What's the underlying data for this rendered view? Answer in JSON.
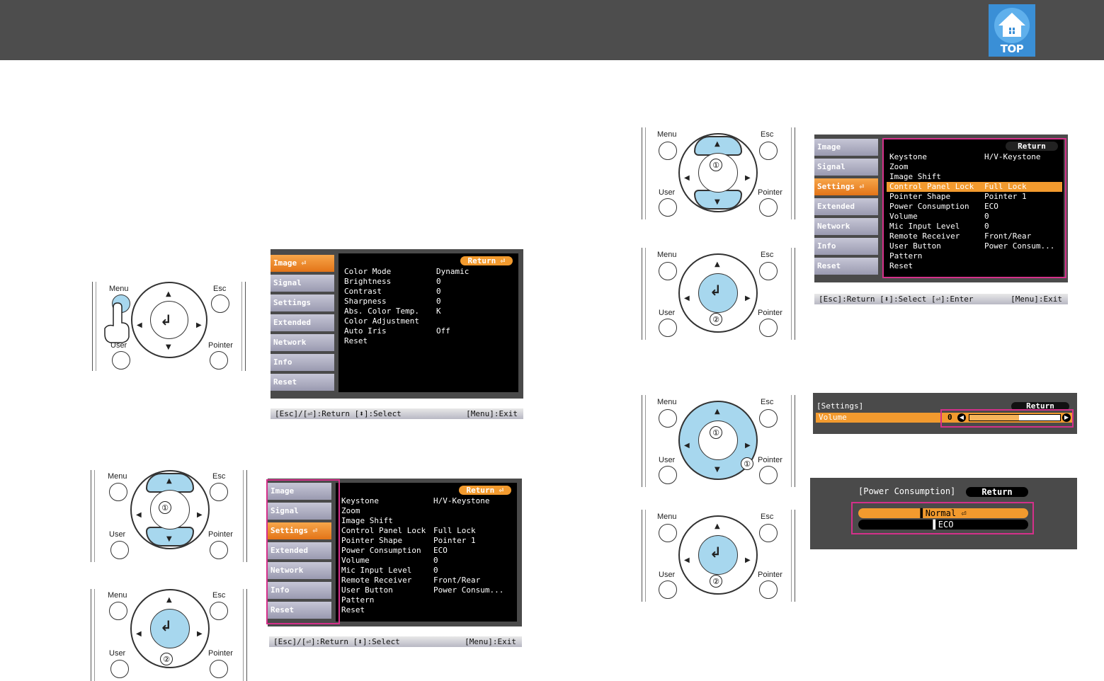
{
  "header": {
    "top_label": "TOP"
  },
  "remote": {
    "menu": "Menu",
    "esc": "Esc",
    "user": "User",
    "pointer": "Pointer",
    "step1": "①",
    "step2": "②"
  },
  "menu_tabs": [
    "Image",
    "Signal",
    "Settings",
    "Extended",
    "Network",
    "Info",
    "Reset"
  ],
  "image_menu": {
    "return": "Return",
    "rows": [
      {
        "k": "Color Mode",
        "v": "Dynamic"
      },
      {
        "k": "Brightness",
        "v": "0"
      },
      {
        "k": "Contrast",
        "v": "0"
      },
      {
        "k": "Sharpness",
        "v": "0"
      },
      {
        "k": "Abs. Color Temp.",
        "v": "K"
      },
      {
        "k": "Color Adjustment",
        "v": ""
      },
      {
        "k": "Auto Iris",
        "v": "Off"
      },
      {
        "k": "Reset",
        "v": ""
      }
    ],
    "hint_left": "[Esc]/[⏎]:Return [⬍]:Select",
    "hint_right": "[Menu]:Exit"
  },
  "settings_menu": {
    "return": "Return",
    "rows": [
      {
        "k": "Keystone",
        "v": "H/V-Keystone"
      },
      {
        "k": "Zoom",
        "v": ""
      },
      {
        "k": "Image Shift",
        "v": ""
      },
      {
        "k": "Control Panel Lock",
        "v": "Full Lock"
      },
      {
        "k": "Pointer Shape",
        "v": "Pointer 1"
      },
      {
        "k": "Power Consumption",
        "v": "ECO"
      },
      {
        "k": "Volume",
        "v": "0"
      },
      {
        "k": "Mic Input Level",
        "v": "0"
      },
      {
        "k": "Remote Receiver",
        "v": "Front/Rear"
      },
      {
        "k": "User Button",
        "v": "Power Consum..."
      },
      {
        "k": "Pattern",
        "v": ""
      },
      {
        "k": "Reset",
        "v": ""
      }
    ],
    "hint_left": "[Esc]/[⏎]:Return [⬍]:Select",
    "hint_right": "[Menu]:Exit"
  },
  "settings_menu_2": {
    "return": "Return",
    "hint_left": "[Esc]:Return [⬍]:Select [⏎]:Enter",
    "hint_right": "[Menu]:Exit"
  },
  "volume_panel": {
    "title": "[Settings]",
    "return": "Return",
    "label": "Volume",
    "value": "0",
    "level": 0.55
  },
  "power_panel": {
    "title": "[Power Consumption]",
    "return": "Return",
    "options": [
      "Normal",
      "ECO"
    ],
    "selected": "Normal"
  }
}
